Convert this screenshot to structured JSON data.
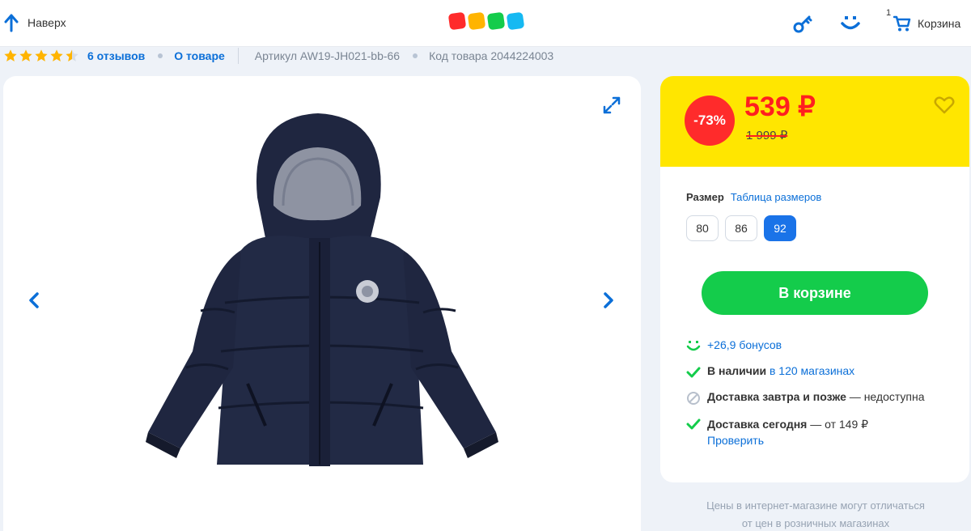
{
  "header": {
    "back_label": "Наверх",
    "logo_colors": [
      "#ff2b2b",
      "#ffb400",
      "#14cc4b",
      "#16b9f2"
    ],
    "cart_count": "1",
    "cart_label": "Корзина"
  },
  "info": {
    "rating": 4.5,
    "reviews": "6 отзывов",
    "about": "О товаре",
    "article": "Артикул AW19-JH021-bb-66",
    "product_code": "Код товара 2044224003"
  },
  "price": {
    "discount": "-73%",
    "current": "539 ₽",
    "old": "1 999 ₽"
  },
  "size": {
    "label": "Размер",
    "table_link": "Таблица размеров",
    "options": [
      "80",
      "86",
      "92"
    ],
    "selected": "92"
  },
  "buy_button": "В корзине",
  "details": {
    "bonus": "+26,9 бонусов",
    "stock_bold": "В наличии",
    "stock_link": "в 120 магазинах",
    "delivery_tomorrow_bold": "Доставка завтра и позже",
    "delivery_tomorrow_rest": " — недоступна",
    "delivery_today_bold": "Доставка сегодня",
    "delivery_today_rest": " — от 149 ₽",
    "check_link": "Проверить"
  },
  "note_lines": [
    "Цены в интернет-магазине могут отличаться",
    "от цен в розничных магазинах"
  ],
  "colors": {
    "accent": "#0b6fd8",
    "yellow": "#ffe600",
    "green": "#14cc4b",
    "red": "#ff1f1f"
  }
}
